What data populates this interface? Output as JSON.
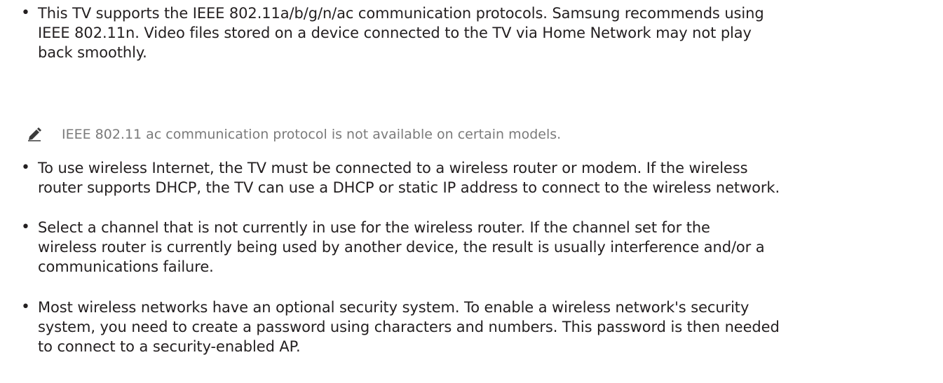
{
  "bullets": [
    {
      "text": "This TV supports the IEEE 802.11a/b/g/n/ac communication protocols. Samsung recommends using\nIEEE 802.11n. Video files stored on a device connected to the TV via Home Network may not play\nback smoothly."
    },
    {
      "text": "To use wireless Internet, the TV must be connected to a wireless router or modem. If the wireless\nrouter supports DHCP, the TV can use a DHCP or static IP address to connect to the wireless network."
    },
    {
      "text": "Select a channel that is not currently in use for the wireless router. If the channel set for the\nwireless router is currently being used by another device, the result is usually interference and/or a\ncommunications failure."
    },
    {
      "text": "Most wireless networks have an optional security system. To enable a wireless network's security\nsystem, you need to create a password using characters and numbers. This password is then needed\nto connect to a security-enabled AP."
    }
  ],
  "note": {
    "icon": "pencil-icon",
    "text": "IEEE 802.11 ac communication protocol is not available on certain models."
  }
}
